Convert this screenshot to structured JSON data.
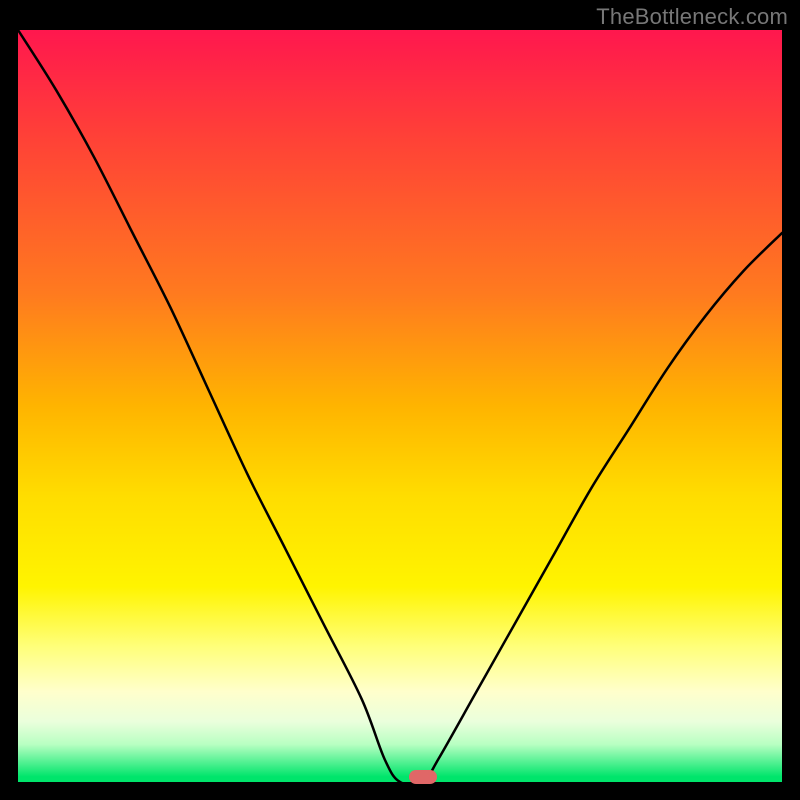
{
  "attribution": "TheBottleneck.com",
  "accent_color": "#e06767",
  "chart_data": {
    "type": "line",
    "title": "",
    "xlabel": "",
    "ylabel": "",
    "xlim": [
      0,
      100
    ],
    "ylim": [
      0,
      100
    ],
    "grid": false,
    "legend": false,
    "background": "rainbow-vertical",
    "x": [
      0,
      5,
      10,
      15,
      20,
      25,
      30,
      35,
      40,
      45,
      48,
      50,
      53,
      55,
      60,
      65,
      70,
      75,
      80,
      85,
      90,
      95,
      100
    ],
    "y": [
      100,
      92,
      83,
      73,
      63,
      52,
      41,
      31,
      21,
      11,
      3,
      0,
      0,
      3,
      12,
      21,
      30,
      39,
      47,
      55,
      62,
      68,
      73
    ],
    "curve_style": {
      "color": "#000000",
      "width": 2.5
    },
    "marker": {
      "x": 53,
      "y": 0.7,
      "color": "#e06767",
      "shape": "pill"
    }
  }
}
